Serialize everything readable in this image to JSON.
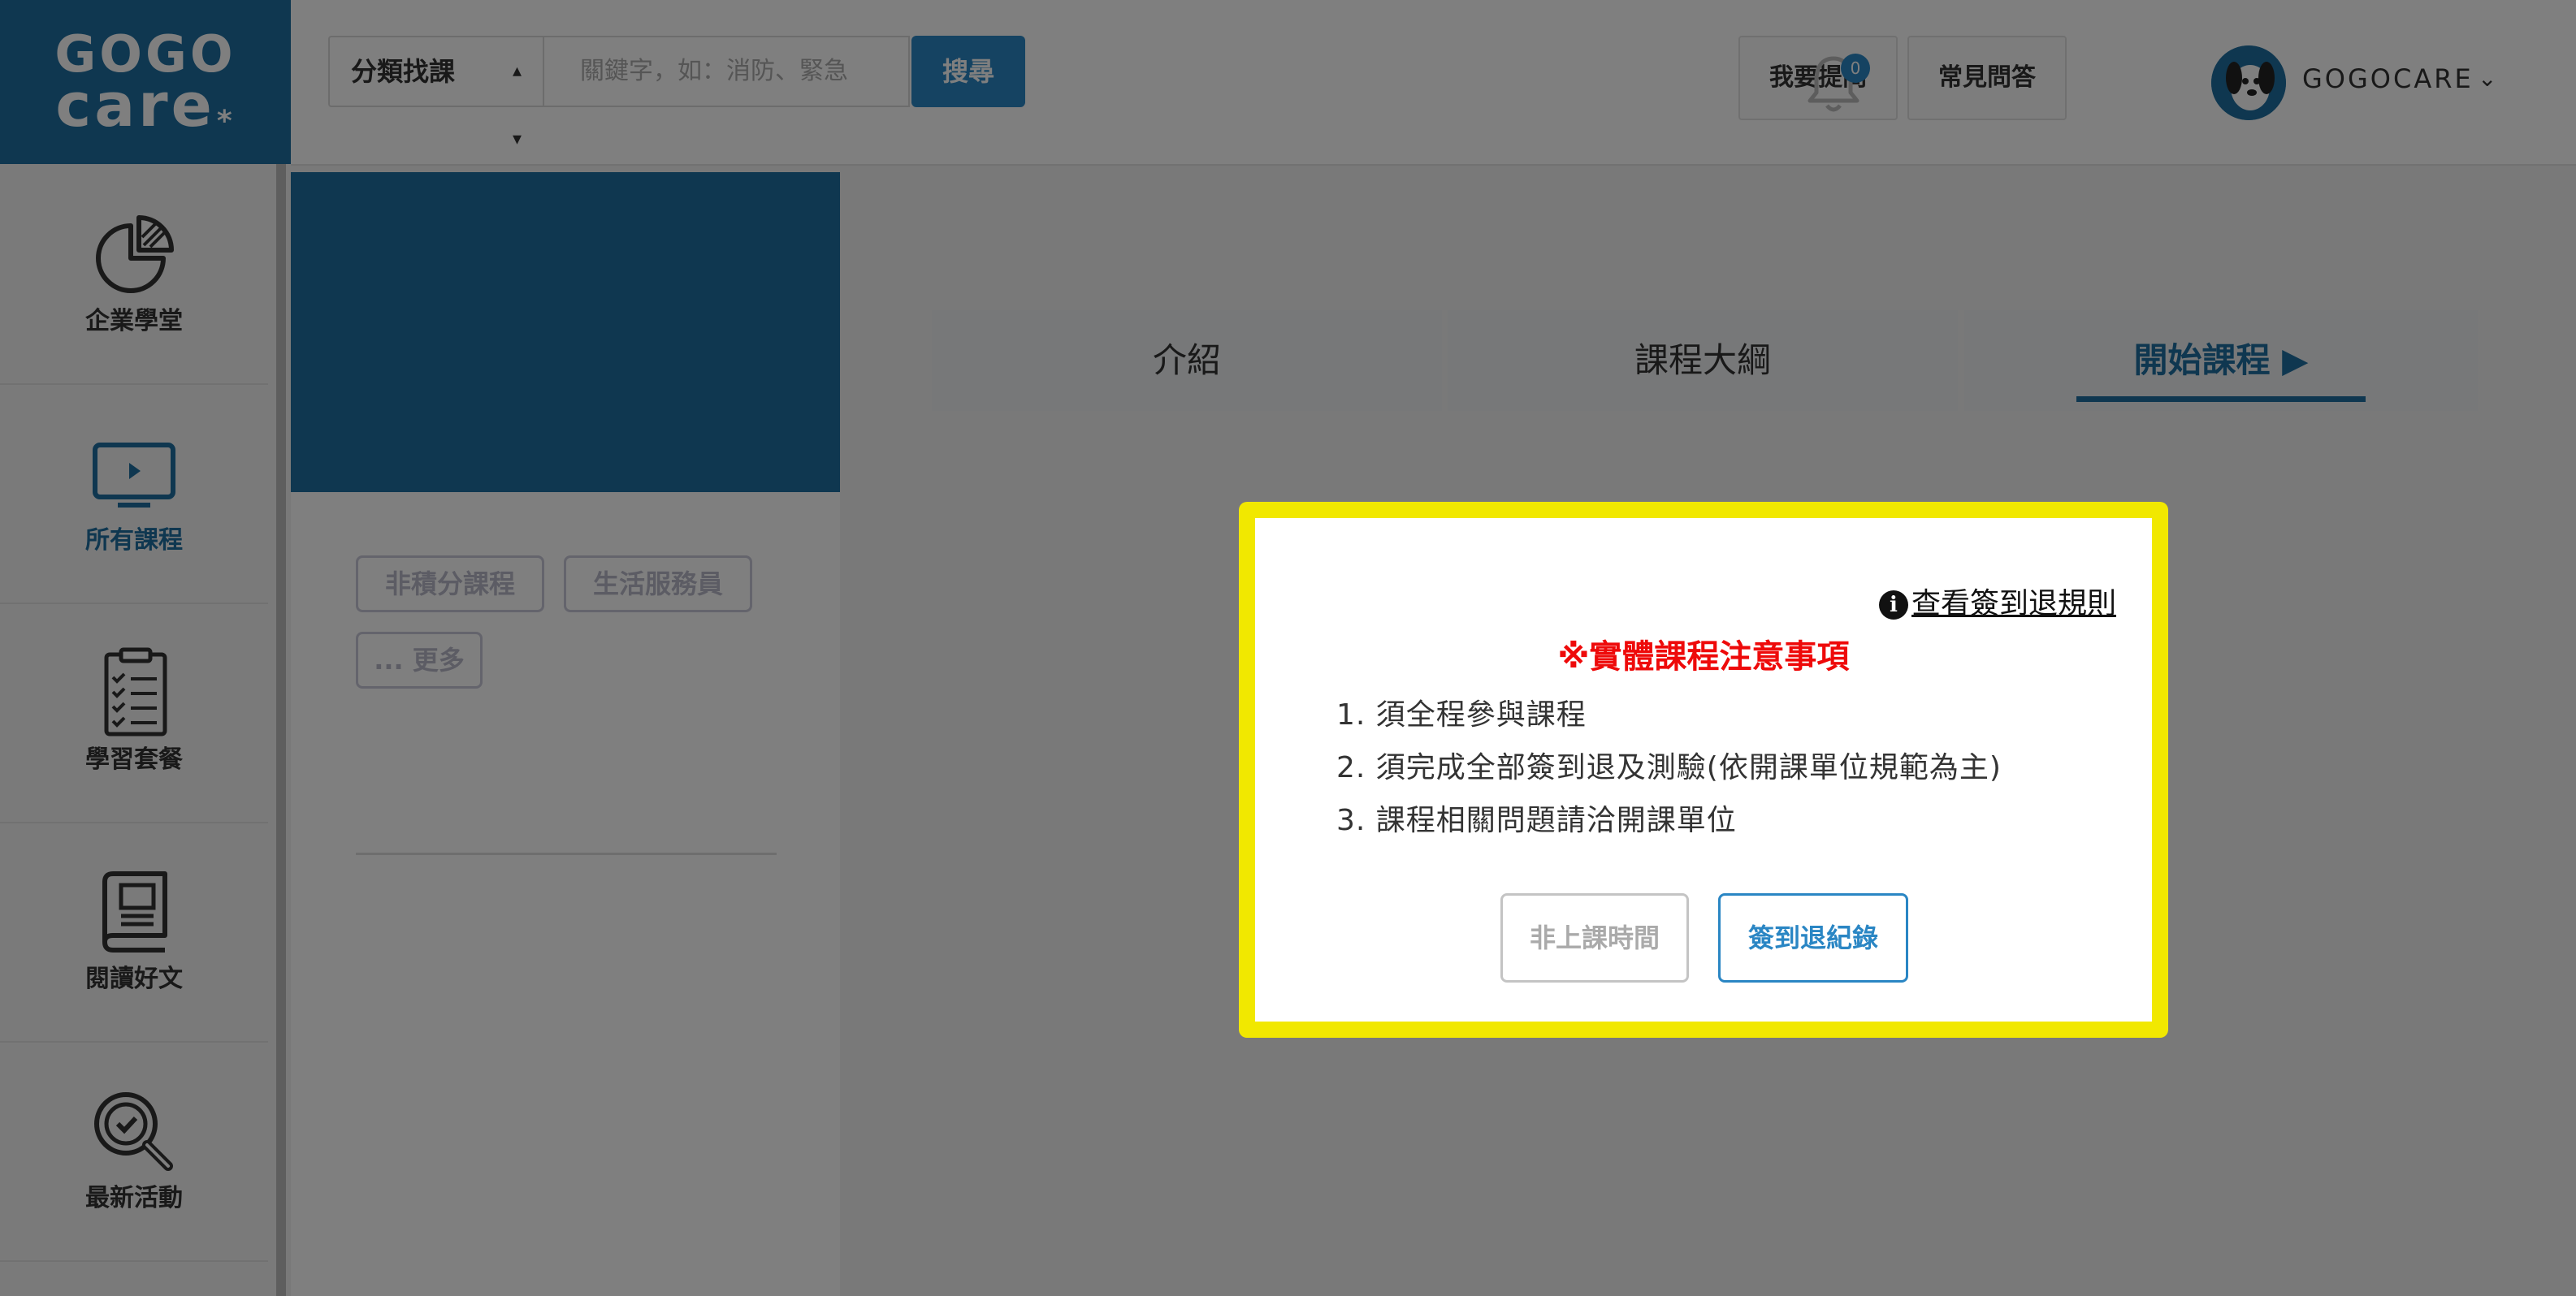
{
  "logo": {
    "line1": "GOGO",
    "line2": "care",
    "mark": "*"
  },
  "header": {
    "category_select": "分類找課",
    "search_placeholder": "關鍵字，如：消防、緊急",
    "search_button": "搜尋",
    "ask_button": "我要提問",
    "faq_button": "常見問答",
    "notification_count": "0",
    "username": "GOGOCARE"
  },
  "sidebar": {
    "items": [
      {
        "label": "企業學堂",
        "icon": "pie-chart-icon"
      },
      {
        "label": "所有課程",
        "icon": "monitor-play-icon"
      },
      {
        "label": "學習套餐",
        "icon": "checklist-icon"
      },
      {
        "label": "閱讀好文",
        "icon": "book-icon"
      },
      {
        "label": "最新活動",
        "icon": "search-check-icon"
      }
    ]
  },
  "course": {
    "tags": [
      "非積分課程",
      "生活服務員",
      "... 更多"
    ]
  },
  "tabs": {
    "intro": "介紹",
    "outline": "課程大綱",
    "start": "開始課程",
    "start_icon": "▶"
  },
  "modal": {
    "rules_link": "查看簽到退規則",
    "notice_title": "※實體課程注意事項",
    "notices": [
      "1. 須全程參與課程",
      "2. 須完成全部簽到退及測驗(依開課單位規範為主)",
      "3. 課程相關問題請洽開課單位"
    ],
    "off_hours_button": "非上課時間",
    "signin_record_button": "簽到退紀錄"
  },
  "colors": {
    "brand": "#1f6fa0",
    "accent": "#2a86c4",
    "highlight_border": "#f1e800",
    "notice_red": "#ee0a0a"
  }
}
